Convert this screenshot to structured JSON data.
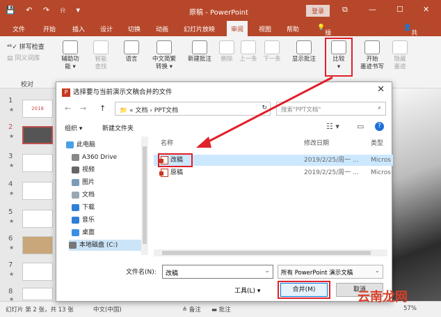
{
  "app": {
    "title": "原稿 - PowerPoint",
    "login": "登录",
    "window_controls": [
      "⧉",
      "—",
      "☐",
      "✕"
    ],
    "quick_access": [
      "💾",
      "↶",
      "↷",
      "⍾",
      "▾"
    ]
  },
  "tabs": [
    "文件",
    "开始",
    "插入",
    "设计",
    "切换",
    "动画",
    "幻灯片放映",
    "审阅",
    "视图",
    "帮助",
    "操作说明搜索",
    "共享"
  ],
  "active_tab": "审阅",
  "ribbon": {
    "spell": "拼写检查",
    "thesaurus": "同义词库",
    "proofing_group": "校对",
    "accessibility": "辅助功\n能 ▾",
    "smart_lookup": "智能\n查找",
    "language": "语言",
    "chinese_convert": "中文简繁\n转换 ▾",
    "new_comment": "新建批注",
    "delete": "删除",
    "prev": "上一条",
    "next": "下一条",
    "show_comments": "显示批注",
    "compare": "比较\n▾",
    "ink_start": "开始\n墨迹书写",
    "ink_hide": "隐藏\n墨迹"
  },
  "slides": [
    {
      "num": "1",
      "star": "★"
    },
    {
      "num": "2",
      "star": "★"
    },
    {
      "num": "3",
      "star": "★"
    },
    {
      "num": "4",
      "star": "★"
    },
    {
      "num": "5",
      "star": "★"
    },
    {
      "num": "6",
      "star": "★"
    },
    {
      "num": "7",
      "star": "★"
    },
    {
      "num": "8",
      "star": "★"
    }
  ],
  "thumb1_text": "2018",
  "dialog": {
    "title": "选择要与当前演示文稿合并的文件",
    "close": "✕",
    "nav": [
      "←",
      "→",
      "↑"
    ],
    "path": "« 文档 › PPT文档",
    "refresh": "↻",
    "search_placeholder": "搜索\"PPT文档\"",
    "organize": "组织 ▾",
    "new_folder": "新建文件夹",
    "tree": [
      "此电脑",
      "A360 Drive",
      "视频",
      "图片",
      "文档",
      "下载",
      "音乐",
      "桌面",
      "本地磁盘 (C:)"
    ],
    "columns": [
      "名称",
      "修改日期",
      "类型"
    ],
    "files": [
      {
        "name": "改稿",
        "date": "2019/2/25/周一 ...",
        "type": "Micros"
      },
      {
        "name": "原稿",
        "date": "2019/2/25/周一 ...",
        "type": "Micros"
      }
    ],
    "filename_label": "文件名(N):",
    "filename_value": "改稿",
    "filetype": "所有 PowerPoint 演示文稿",
    "tools": "工具(L)",
    "merge": "合并(M)",
    "cancel": "取消"
  },
  "status": {
    "slide_info": "幻灯片 第 2 张，共 13 张",
    "lang": "中文(中国)",
    "notes": "备注",
    "comments": "批注",
    "zoom": "57%"
  },
  "watermark": "云南龙网",
  "colors": {
    "accent": "#b7472a",
    "highlight": "#e0202a"
  }
}
